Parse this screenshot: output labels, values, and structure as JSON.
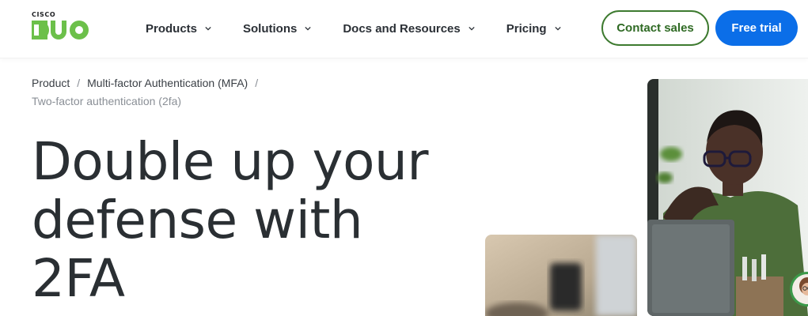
{
  "brand": {
    "top": "CISCO",
    "name": "DUO",
    "color": "#6cc04a"
  },
  "nav": {
    "items": [
      {
        "label": "Products"
      },
      {
        "label": "Solutions"
      },
      {
        "label": "Docs and Resources"
      },
      {
        "label": "Pricing"
      }
    ]
  },
  "actions": {
    "contact_label": "Contact sales",
    "trial_label": "Free trial",
    "contact_color": "#3d7a2f",
    "trial_color": "#0b6ee8"
  },
  "breadcrumb": {
    "items": [
      {
        "label": "Product"
      },
      {
        "label": "Multi-factor Authentication (MFA)"
      }
    ],
    "current": "Two-factor authentication (2fa)"
  },
  "hero": {
    "title_lines": [
      "Double up your",
      "defense with",
      "2FA"
    ]
  },
  "icons": {
    "chevron": "chevron-down-icon",
    "avatar": "support-avatar"
  }
}
